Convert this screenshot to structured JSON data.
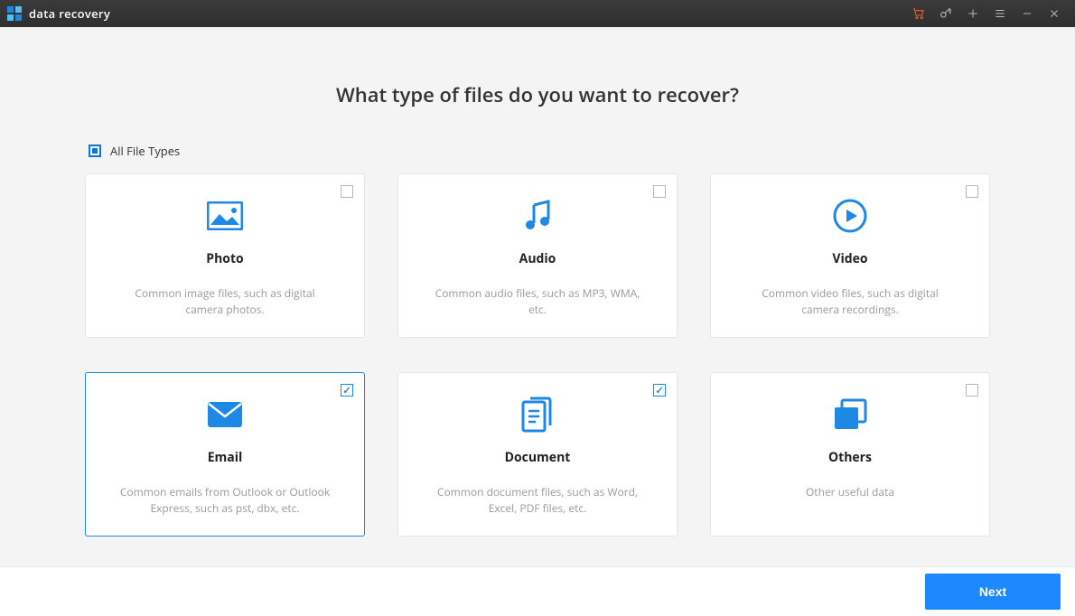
{
  "app": {
    "title": "data recovery"
  },
  "heading": "What type of files do you want to recover?",
  "all_types": {
    "label": "All File Types",
    "state": "indeterminate"
  },
  "cards": [
    {
      "id": "photo",
      "title": "Photo",
      "desc": "Common image files, such as digital camera photos.",
      "checked": false,
      "outlined": false
    },
    {
      "id": "audio",
      "title": "Audio",
      "desc": "Common audio files, such as MP3, WMA, etc.",
      "checked": false,
      "outlined": false
    },
    {
      "id": "video",
      "title": "Video",
      "desc": "Common video files, such as digital camera recordings.",
      "checked": false,
      "outlined": false
    },
    {
      "id": "email",
      "title": "Email",
      "desc": "Common emails from Outlook or Outlook Express, such as pst, dbx, etc.",
      "checked": true,
      "outlined": true
    },
    {
      "id": "document",
      "title": "Document",
      "desc": "Common document files, such as Word, Excel, PDF files, etc.",
      "checked": true,
      "outlined": false
    },
    {
      "id": "others",
      "title": "Others",
      "desc": "Other useful data",
      "checked": false,
      "outlined": false
    }
  ],
  "footer": {
    "next_label": "Next"
  },
  "colors": {
    "accent": "#1e88e5",
    "accent_bright": "#1e88ff",
    "cart": "#ff5a2b"
  }
}
